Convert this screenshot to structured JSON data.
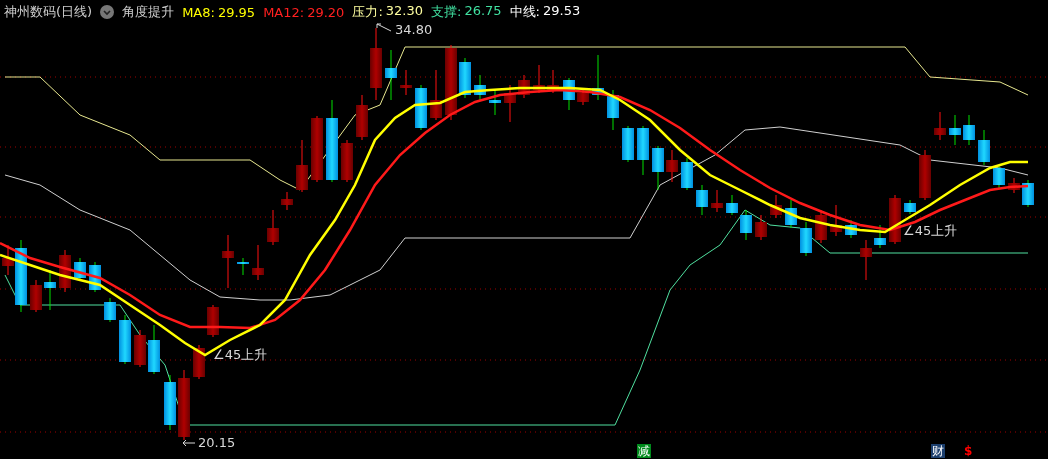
{
  "header": {
    "title": "神州数码(日线)",
    "indicator": "角度提升",
    "values": [
      {
        "label": "MA8:",
        "value": "29.95",
        "color": "#ffff00"
      },
      {
        "label": "MA12:",
        "value": "29.20",
        "color": "#ff2020"
      },
      {
        "label": "压力:",
        "value": "32.30",
        "color": "#ffffa0"
      },
      {
        "label": "支撑:",
        "value": "26.75",
        "color": "#40e0a0"
      },
      {
        "label": "中线:",
        "value": "29.53",
        "color": "#ffffff"
      }
    ]
  },
  "annotations": [
    {
      "kind": "high",
      "text": "34.80"
    },
    {
      "kind": "low",
      "text": "20.15"
    },
    {
      "kind": "signal",
      "text": "∠45上升"
    },
    {
      "kind": "signal",
      "text": "∠45上升"
    }
  ],
  "markers": [
    {
      "kind": "badge",
      "text": "减",
      "color": "#008a1c"
    },
    {
      "kind": "badge",
      "text": "财",
      "color": "#1c3f6e"
    },
    {
      "kind": "glyph",
      "text": "$",
      "color": "#ff0000"
    }
  ]
}
